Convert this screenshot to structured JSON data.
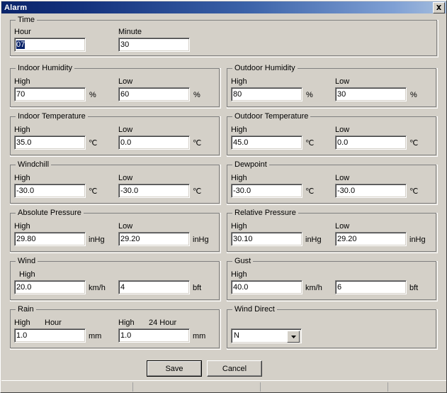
{
  "window": {
    "title": "Alarm",
    "close_label": "✕"
  },
  "groups": {
    "time": {
      "title": "Time",
      "hour": {
        "label": "Hour",
        "value": "07",
        "selected": true
      },
      "minute": {
        "label": "Minute",
        "value": "30"
      }
    },
    "indoor_humidity": {
      "title": "Indoor Humidity",
      "high": {
        "label": "High",
        "value": "70",
        "unit": "%"
      },
      "low": {
        "label": "Low",
        "value": "60",
        "unit": "%"
      }
    },
    "outdoor_humidity": {
      "title": "Outdoor Humidity",
      "high": {
        "label": "High",
        "value": "80",
        "unit": "%"
      },
      "low": {
        "label": "Low",
        "value": "30",
        "unit": "%"
      }
    },
    "indoor_temperature": {
      "title": "Indoor Temperature",
      "high": {
        "label": "High",
        "value": "35.0",
        "unit": "℃"
      },
      "low": {
        "label": "Low",
        "value": "0.0",
        "unit": "℃"
      }
    },
    "outdoor_temperature": {
      "title": "Outdoor Temperature",
      "high": {
        "label": "High",
        "value": "45.0",
        "unit": "℃"
      },
      "low": {
        "label": "Low",
        "value": "0.0",
        "unit": "℃"
      }
    },
    "windchill": {
      "title": "Windchill",
      "high": {
        "label": "High",
        "value": "-30.0",
        "unit": "℃"
      },
      "low": {
        "label": "Low",
        "value": "-30.0",
        "unit": "℃"
      }
    },
    "dewpoint": {
      "title": "Dewpoint",
      "high": {
        "label": "High",
        "value": "-30.0",
        "unit": "℃"
      },
      "low": {
        "label": "Low",
        "value": "-30.0",
        "unit": "℃"
      }
    },
    "absolute_pressure": {
      "title": "Absolute Pressure",
      "high": {
        "label": "High",
        "value": "29.80",
        "unit": "inHg"
      },
      "low": {
        "label": "Low",
        "value": "29.20",
        "unit": "inHg"
      }
    },
    "relative_pressure": {
      "title": "Relative Pressure",
      "high": {
        "label": "High",
        "value": "30.10",
        "unit": "inHg"
      },
      "low": {
        "label": "Low",
        "value": "29.20",
        "unit": "inHg"
      }
    },
    "wind": {
      "title": "Wind",
      "label": "High",
      "speed": {
        "value": "20.0",
        "unit": "km/h"
      },
      "beaufort": {
        "value": "4",
        "unit": "bft"
      }
    },
    "gust": {
      "title": "Gust",
      "label": "High",
      "speed": {
        "value": "40.0",
        "unit": "km/h"
      },
      "beaufort": {
        "value": "6",
        "unit": "bft"
      }
    },
    "rain": {
      "title": "Rain",
      "hour": {
        "label_high": "High",
        "label_period": "Hour",
        "value": "1.0",
        "unit": "mm"
      },
      "day": {
        "label_high": "High",
        "label_period": "24 Hour",
        "value": "1.0",
        "unit": "mm"
      }
    },
    "wind_direct": {
      "title": "Wind Direct",
      "value": "N"
    }
  },
  "buttons": {
    "save": "Save",
    "cancel": "Cancel"
  }
}
